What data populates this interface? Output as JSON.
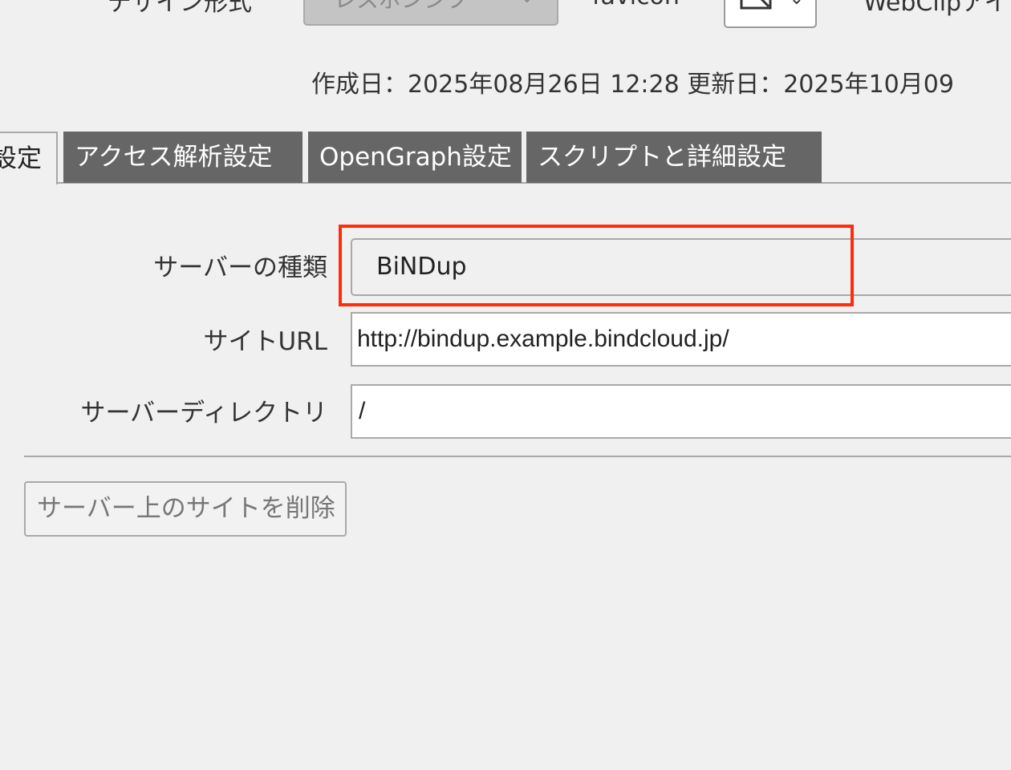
{
  "top_strip": {
    "design_label": "デザイン形式",
    "design_value": "レスポンシブ",
    "favicon_label": "favicon",
    "webclip_label": "WebClipアイ"
  },
  "dates": {
    "text": "作成日：2025年08月26日 12:28 更新日：2025年10月09"
  },
  "tabs": [
    {
      "label": "設定",
      "active": true
    },
    {
      "label": "アクセス解析設定",
      "active": false
    },
    {
      "label": "OpenGraph設定",
      "active": false
    },
    {
      "label": "スクリプトと詳細設定",
      "active": false
    }
  ],
  "form": {
    "server_type": {
      "label": "サーバーの種類",
      "value": "BiNDup"
    },
    "site_url": {
      "label": "サイトURL",
      "value": "http://bindup.example.bindcloud.jp/"
    },
    "server_dir": {
      "label": "サーバーディレクトリ",
      "value": "/"
    }
  },
  "actions": {
    "delete_label": "サーバー上のサイトを削除"
  },
  "colors": {
    "highlight": "#ff2d0a",
    "tab_inactive_bg": "#666666",
    "background": "#f0f0f0"
  },
  "icons": {
    "favicon": "image-placeholder-icon",
    "dropdown": "chevron-down-icon"
  }
}
